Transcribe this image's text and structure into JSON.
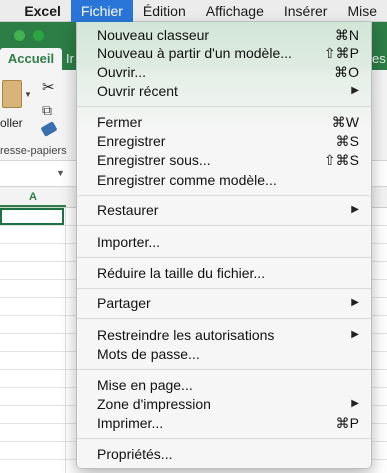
{
  "menubar": {
    "apple_icon": "apple-icon",
    "items": [
      {
        "label": "Excel"
      },
      {
        "label": "Fichier"
      },
      {
        "label": "Édition"
      },
      {
        "label": "Affichage"
      },
      {
        "label": "Insérer"
      },
      {
        "label": "Mise"
      }
    ],
    "active_color": "#2a76d8"
  },
  "window": {
    "brand_color": "#2d7d46",
    "tab_active": "Accueil",
    "tab_side_left": "Ir",
    "tab_side_right": "es",
    "paste_label": "oller",
    "clipboard_label": "resse-papiers",
    "column_a": "A"
  },
  "menu": {
    "groups": [
      [
        {
          "label": "Nouveau classeur",
          "shortcut": "⌘N"
        },
        {
          "label": "Nouveau à partir d'un modèle...",
          "shortcut": "⇧⌘P"
        },
        {
          "label": "Ouvrir...",
          "shortcut": "⌘O"
        },
        {
          "label": "Ouvrir récent",
          "submenu": "▶"
        }
      ],
      [
        {
          "label": "Fermer",
          "shortcut": "⌘W"
        },
        {
          "label": "Enregistrer",
          "shortcut": "⌘S"
        },
        {
          "label": "Enregistrer sous...",
          "shortcut": "⇧⌘S"
        },
        {
          "label": "Enregistrer comme modèle..."
        }
      ],
      [
        {
          "label": "Restaurer",
          "submenu": "▶"
        }
      ],
      [
        {
          "label": "Importer..."
        }
      ],
      [
        {
          "label": "Réduire la taille du fichier..."
        }
      ],
      [
        {
          "label": "Partager",
          "submenu": "▶"
        }
      ],
      [
        {
          "label": "Restreindre les autorisations",
          "submenu": "▶"
        },
        {
          "label": "Mots de passe..."
        }
      ],
      [
        {
          "label": "Mise en page..."
        },
        {
          "label": "Zone d'impression",
          "submenu": "▶"
        },
        {
          "label": "Imprimer...",
          "shortcut": "⌘P"
        }
      ],
      [
        {
          "label": "Propriétés..."
        }
      ]
    ]
  }
}
